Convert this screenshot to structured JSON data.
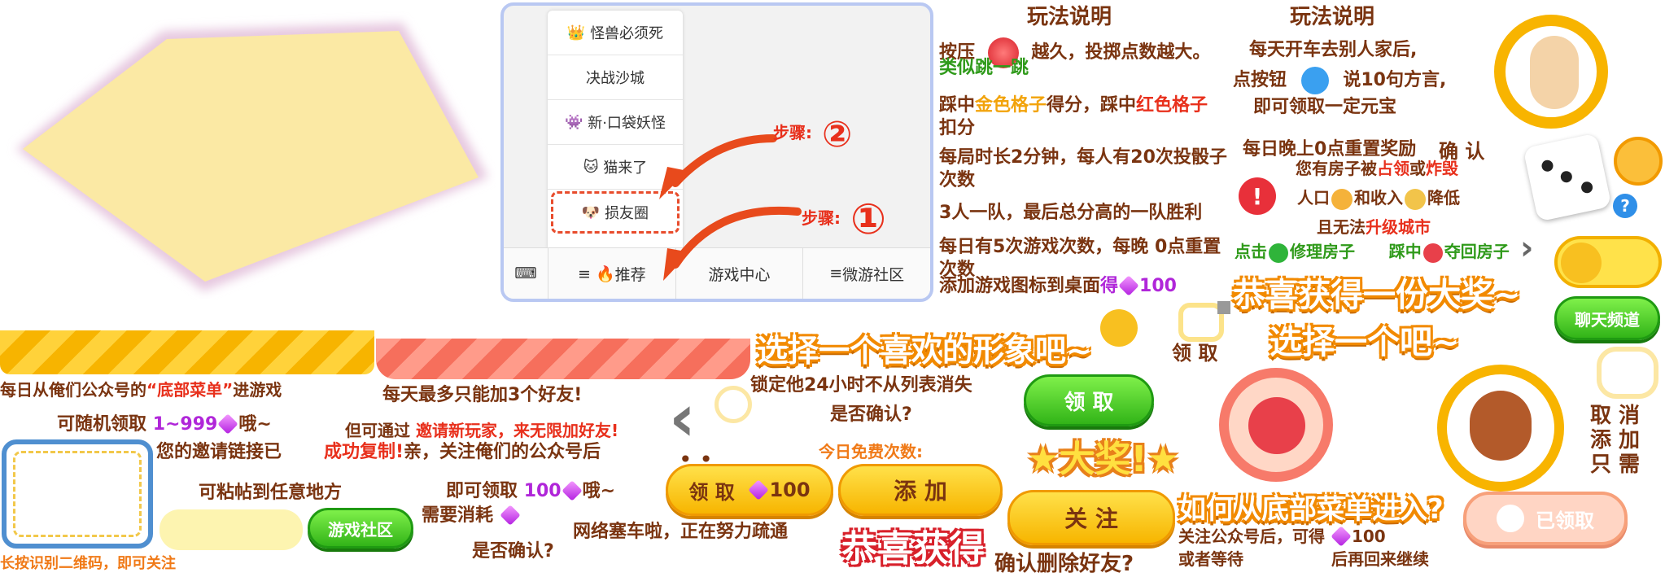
{
  "menu": {
    "items": [
      "怪兽必须死",
      "决战沙城",
      "新·口袋妖怪",
      "猫来了",
      "损友圈"
    ],
    "tabs": [
      "推荐",
      "游戏中心",
      "微游社区"
    ],
    "step1": "步骤:",
    "step1_num": "①",
    "step2": "步骤:",
    "step2_num": "②"
  },
  "rules_left": {
    "title": "玩法说明",
    "line1a": "按压",
    "line1b": "越久，投掷点数越大。",
    "line2": "类似跳一跳",
    "line3a": "踩中",
    "line3b": "金色格子",
    "line3c": "得分，踩中",
    "line3d": "红色格子",
    "line3e": "扣分",
    "line4": "每局时长2分钟，每人有20次投骰子次数",
    "line5": "3人一队，最后总分高的一队胜利",
    "line6": "每日有5次游戏次数，每晚   0点重置次数",
    "line7a": "添加游戏图标到桌面",
    "line7b": "得",
    "line7c": "100"
  },
  "rules_right": {
    "title": "玩法说明",
    "line1": "每天开车去别人家后,",
    "line2a": "点按钮",
    "line2b": "说10句方言,",
    "line3": "即可领取一定元宝",
    "line4a": "每日晚上0点重置奖励",
    "confirm": "确  认",
    "line5a": "您有房子被",
    "line5b": "占领",
    "line5c": "或",
    "line5d": "炸毁",
    "line6a": "人口",
    "line6b": "和收入",
    "line6c": "降低",
    "line7a": "且无法",
    "line7b": "升级城市",
    "line8a": "点击",
    "line8b": "修理房子",
    "line8c": "踩中",
    "line8d": "夺回房子"
  },
  "banners": {
    "big_prize": "恭喜获得一份大奖~",
    "choose_one": "选择一个吧~",
    "choose_avatar": "选择一个喜欢的形象吧~",
    "congrats": "恭喜获得",
    "prize": "大奖!",
    "how_enter": "如何从底部菜单进入?"
  },
  "texts": {
    "daily_menu_a": "每日从俺们公众号的",
    "daily_menu_b": "“底部菜单”",
    "daily_menu_c": "进游戏",
    "random_a": "可随机领取",
    "random_b": "1~999",
    "random_c": "哦~",
    "invite_copied_a": "您的邀请链接已",
    "invite_copied_b": "成功复制!",
    "invite_copied_c": "亲，关注俺们的公众号后",
    "paste_anywhere": "可粘帖到任意地方",
    "long_press": "长按识别二维码，即可关注",
    "max_friends": "每天最多只能加3个好友!",
    "invite_unlimited_a": "但可通过",
    "invite_unlimited_b": "邀请新玩家，来无限加好友!",
    "lock_24h": "锁定他24小时不从列表消失",
    "confirm_q": "是否确认?",
    "free_times": "今日免费次数:",
    "get_100_a": "即可领取",
    "get_100_b": "100",
    "get_100_c": "哦~",
    "need_cost": "需要消耗",
    "confirm_q2": "是否确认?",
    "network_busy": "网络塞车啦，正在努力疏通",
    "delete_friend": "确认删除好友?",
    "follow_after_a": "关注公众号后，可得",
    "follow_after_b": "100",
    "or_wait": "或者等待",
    "come_back": "后再回来继续",
    "claim_right": "领 取",
    "cancel_add": "取 消\n添 加\n只 需"
  },
  "buttons": {
    "claim": "领 取",
    "claim_100": "领 取",
    "claim_100_amount": "100",
    "add": "添 加",
    "follow": "关 注",
    "game_community": "游戏社区",
    "chat_channel": "聊天频道",
    "claimed": "已领取"
  },
  "colors": {
    "brown_text": "#7a3410",
    "yellow_button": "#f7b500",
    "green_button": "#32b418",
    "red_text": "#e8301c",
    "gold_text": "#f2a30a",
    "purple_gem": "#b21fe0"
  }
}
